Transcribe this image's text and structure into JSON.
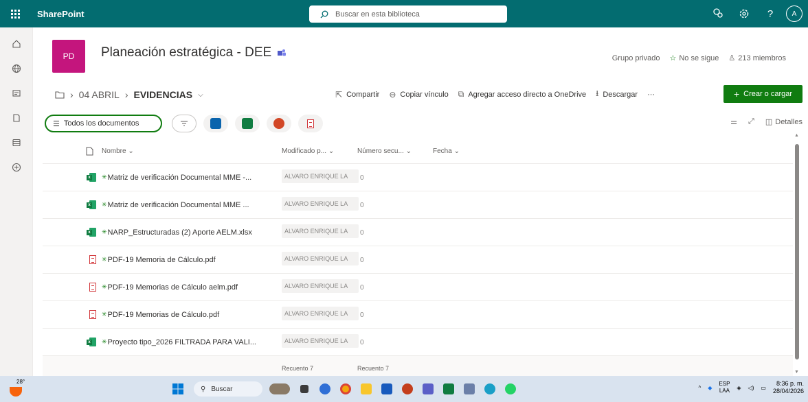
{
  "suite": {
    "brand": "SharePoint",
    "search_placeholder": "Buscar en esta biblioteca",
    "avatar_initial": "A",
    "help": "?"
  },
  "site": {
    "logo": "PD",
    "title": "Planeación estratégica - DEE",
    "privacy": "Grupo privado",
    "follow": "No se sigue",
    "members": "213 miembros"
  },
  "breadcrumb": {
    "parent": "04 ABRIL",
    "current": "EVIDENCIAS"
  },
  "commands": {
    "share": "Compartir",
    "copy_link": "Copiar vínculo",
    "onedrive": "Agregar acceso directo a OneDrive",
    "download": "Descargar",
    "more": "···",
    "create": "Crear o cargar"
  },
  "view": {
    "name": "Todos los documentos",
    "details": "Detalles"
  },
  "list": {
    "columns": {
      "name": "Nombre",
      "modified_by": "Modificado p...",
      "seq": "Número secu...",
      "date": "Fecha"
    },
    "rows": [
      {
        "type": "xlsx",
        "name": "Matriz de verificación Documental MME -...",
        "modified_by": "ALVARO ENRIQUE LA",
        "seq": "0"
      },
      {
        "type": "xlsx",
        "name": "Matriz de verificación Documental MME ...",
        "modified_by": "ALVARO ENRIQUE LA",
        "seq": "0"
      },
      {
        "type": "xlsx",
        "name": "NARP_Estructuradas (2) Aporte AELM.xlsx",
        "modified_by": "ALVARO ENRIQUE LA",
        "seq": "0"
      },
      {
        "type": "pdf",
        "name": "PDF-19 Memoria de Cálculo.pdf",
        "modified_by": "ALVARO ENRIQUE LA",
        "seq": "0"
      },
      {
        "type": "pdf",
        "name": "PDF-19 Memorias de Cálculo aelm.pdf",
        "modified_by": "ALVARO ENRIQUE LA",
        "seq": "0"
      },
      {
        "type": "pdf",
        "name": "PDF-19 Memorias de Cálculo.pdf",
        "modified_by": "ALVARO ENRIQUE LA",
        "seq": "0"
      },
      {
        "type": "xlsx",
        "name": "Proyecto tipo_2026 FILTRADA PARA VALI...",
        "modified_by": "ALVARO ENRIQUE LA",
        "seq": "0"
      }
    ],
    "footer": {
      "count1": "Recuento 7",
      "count2": "Recuento 7"
    }
  },
  "taskbar": {
    "temp": "28°",
    "search": "Buscar",
    "lang1": "ESP",
    "lang2": "LAA",
    "time": "8:36 p. m.",
    "date": "28/04/2026"
  },
  "colors": {
    "suite": "#036c70",
    "logo": "#c4157d",
    "accent": "#107c10"
  }
}
